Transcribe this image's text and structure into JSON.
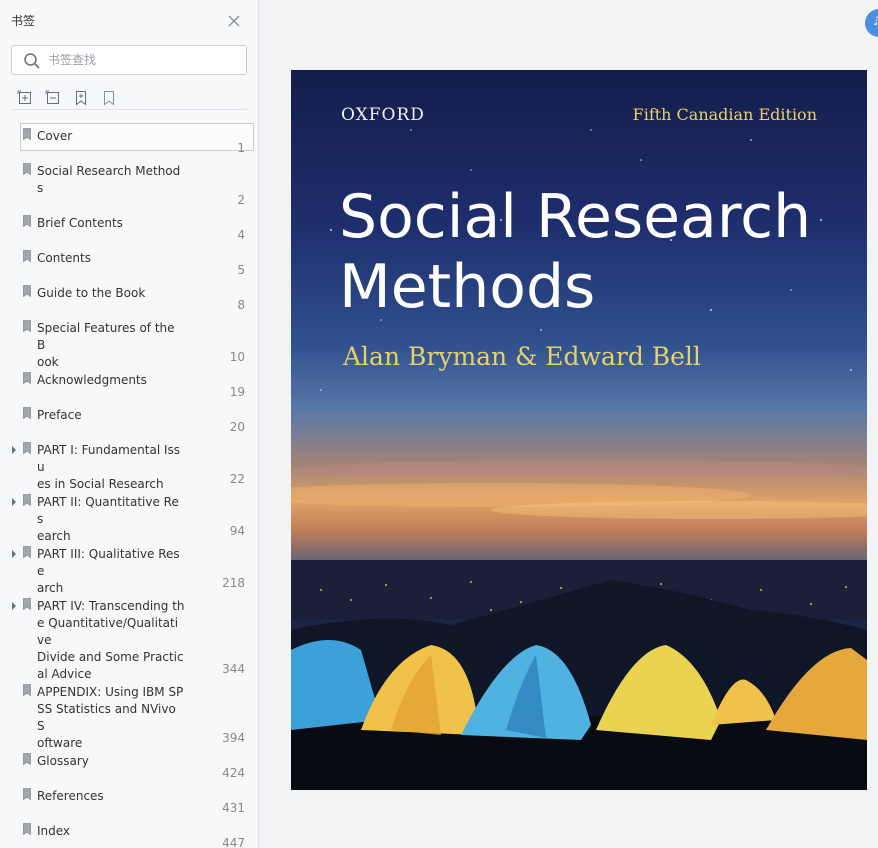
{
  "sidebar": {
    "title": "书签",
    "search_placeholder": "书签查找",
    "bookmarks": [
      {
        "label": "Cover",
        "page": "1",
        "expandable": false,
        "selected": true
      },
      {
        "label": "Social Research Method\ns",
        "page": "2",
        "expandable": false
      },
      {
        "label": "Brief Contents",
        "page": "4",
        "expandable": false
      },
      {
        "label": "Contents",
        "page": "5",
        "expandable": false
      },
      {
        "label": "Guide to the Book",
        "page": "8",
        "expandable": false
      },
      {
        "label": "Special Features of the B\nook",
        "page": "10",
        "expandable": false
      },
      {
        "label": "Acknowledgments",
        "page": "19",
        "expandable": false
      },
      {
        "label": "Preface",
        "page": "20",
        "expandable": false
      },
      {
        "label": "PART I: Fundamental Issu\nes in Social Research",
        "page": "22",
        "expandable": true
      },
      {
        "label": "PART II: Quantitative Res\nearch",
        "page": "94",
        "expandable": true
      },
      {
        "label": "PART III: Qualitative Rese\narch",
        "page": "218",
        "expandable": true
      },
      {
        "label": "PART IV: Transcending th\ne Quantitative/Qualitative\nDivide and Some Practic\nal Advice",
        "page": "344",
        "expandable": true
      },
      {
        "label": "APPENDIX: Using IBM SP\nSS Statistics and NVivo S\noftware",
        "page": "394",
        "expandable": false
      },
      {
        "label": "Glossary",
        "page": "424",
        "expandable": false
      },
      {
        "label": "References",
        "page": "431",
        "expandable": false
      },
      {
        "label": "Index",
        "page": "447",
        "expandable": false
      }
    ]
  },
  "cover": {
    "publisher": "OXFORD",
    "edition": "Fifth Canadian Edition",
    "title": "Social Research\nMethods",
    "authors": "Alan Bryman & Edward Bell"
  },
  "colors": {
    "accent_blue": "#4a90e2",
    "cover_gold": "#e7d26a"
  }
}
